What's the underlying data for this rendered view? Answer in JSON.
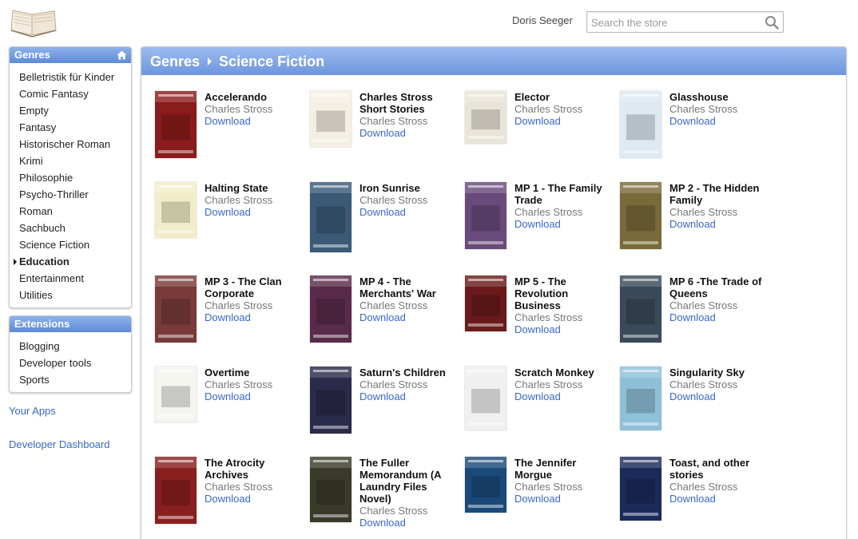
{
  "header": {
    "user_name": "Doris Seeger",
    "search_placeholder": "Search the store"
  },
  "sidebar": {
    "genres_title": "Genres",
    "genres": [
      {
        "label": "Belletristik für Kinder"
      },
      {
        "label": "Comic Fantasy"
      },
      {
        "label": "Empty"
      },
      {
        "label": "Fantasy"
      },
      {
        "label": "Historischer Roman"
      },
      {
        "label": "Krimi"
      },
      {
        "label": "Philosophie"
      },
      {
        "label": "Psycho-Thriller"
      },
      {
        "label": "Roman"
      },
      {
        "label": "Sachbuch"
      },
      {
        "label": "Science Fiction"
      },
      {
        "label": "Education"
      },
      {
        "label": "Entertainment"
      },
      {
        "label": "Utilities"
      }
    ],
    "active_genre": "Education",
    "extensions_title": "Extensions",
    "extensions": [
      {
        "label": "Blogging"
      },
      {
        "label": "Developer tools"
      },
      {
        "label": "Sports"
      }
    ],
    "your_apps": "Your Apps",
    "developer_dashboard": "Developer Dashboard"
  },
  "main": {
    "breadcrumb": [
      "Genres",
      "Science Fiction"
    ],
    "download_label": "Download",
    "books": [
      {
        "title": "Accelerando",
        "author": "Charles Stross",
        "cover": "#8b1c1c"
      },
      {
        "title": "Charles Stross Short Stories",
        "author": "Charles Stross",
        "cover": "#f4efe3"
      },
      {
        "title": "Elector",
        "author": "Charles Stross",
        "cover": "#e9e4d8"
      },
      {
        "title": "Glasshouse",
        "author": "Charles Stross",
        "cover": "#dfe9f2"
      },
      {
        "title": "Halting State",
        "author": "Charles Stross",
        "cover": "#f2edc9"
      },
      {
        "title": "Iron Sunrise",
        "author": "Charles Stross",
        "cover": "#3a5a78"
      },
      {
        "title": "MP 1 - The Family Trade",
        "author": "Charles Stross",
        "cover": "#6a4a7a"
      },
      {
        "title": "MP 2 - The Hidden Family",
        "author": "Charles Stross",
        "cover": "#7a6a3a"
      },
      {
        "title": "MP 3 - The Clan Corporate",
        "author": "Charles Stross",
        "cover": "#7a3a3a"
      },
      {
        "title": "MP 4 - The Merchants' War",
        "author": "Charles Stross",
        "cover": "#5a2a4a"
      },
      {
        "title": "MP 5 - The Revolution Business",
        "author": "Charles Stross",
        "cover": "#6a1a1a"
      },
      {
        "title": "MP 6 -The Trade of Queens",
        "author": "Charles Stross",
        "cover": "#3a4a5a"
      },
      {
        "title": "Overtime",
        "author": "Charles Stross",
        "cover": "#f3f5ee"
      },
      {
        "title": "Saturn's Children",
        "author": "Charles Stross",
        "cover": "#2a2a4a"
      },
      {
        "title": "Scratch Monkey",
        "author": "Charles Stross",
        "cover": "#f0f0f0"
      },
      {
        "title": "Singularity Sky",
        "author": "Charles Stross",
        "cover": "#8ec0d8"
      },
      {
        "title": "The Atrocity Archives",
        "author": "Charles Stross",
        "cover": "#8a1f1f"
      },
      {
        "title": "The Fuller Memorandum (A Laundry Files Novel)",
        "author": "Charles Stross",
        "cover": "#3a3a2a"
      },
      {
        "title": "The Jennifer Morgue",
        "author": "Charles Stross",
        "cover": "#1a4a7a"
      },
      {
        "title": "Toast, and other stories",
        "author": "Charles Stross",
        "cover": "#1a2a5a"
      }
    ]
  },
  "colors": {
    "link": "#3a67c8",
    "header_blue": "#6d96dd"
  }
}
